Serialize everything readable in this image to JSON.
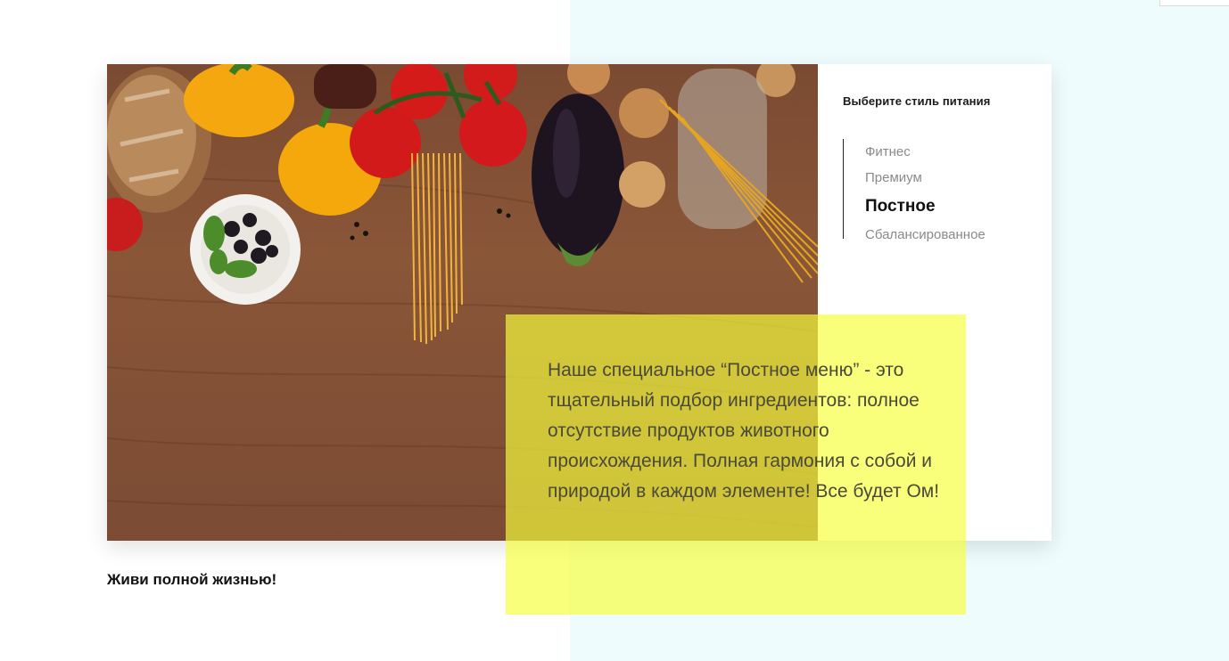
{
  "hero": {
    "image_alt": "Овощи, паста и хлеб на деревянном столе"
  },
  "diet": {
    "title": "Выберите стиль питания",
    "options": [
      {
        "label": "Фитнес",
        "active": false
      },
      {
        "label": "Премиум",
        "active": false
      },
      {
        "label": "Постное",
        "active": true
      },
      {
        "label": "Сбалансированное",
        "active": false
      }
    ]
  },
  "description": {
    "text": "Наше специальное “Постное меню” - это тщательный подбор ингредиентов: полное отсутствие продуктов животного происхождения. Полная гармония с собой и природой в каждом элементе! Все будет Ом!"
  },
  "tagline": "Живи полной жизнью!",
  "colors": {
    "accent_yellow": "#f7ff3c",
    "background_tint": "#eefcfd",
    "text_dark": "#111111",
    "text_muted": "#8a8a8a"
  }
}
